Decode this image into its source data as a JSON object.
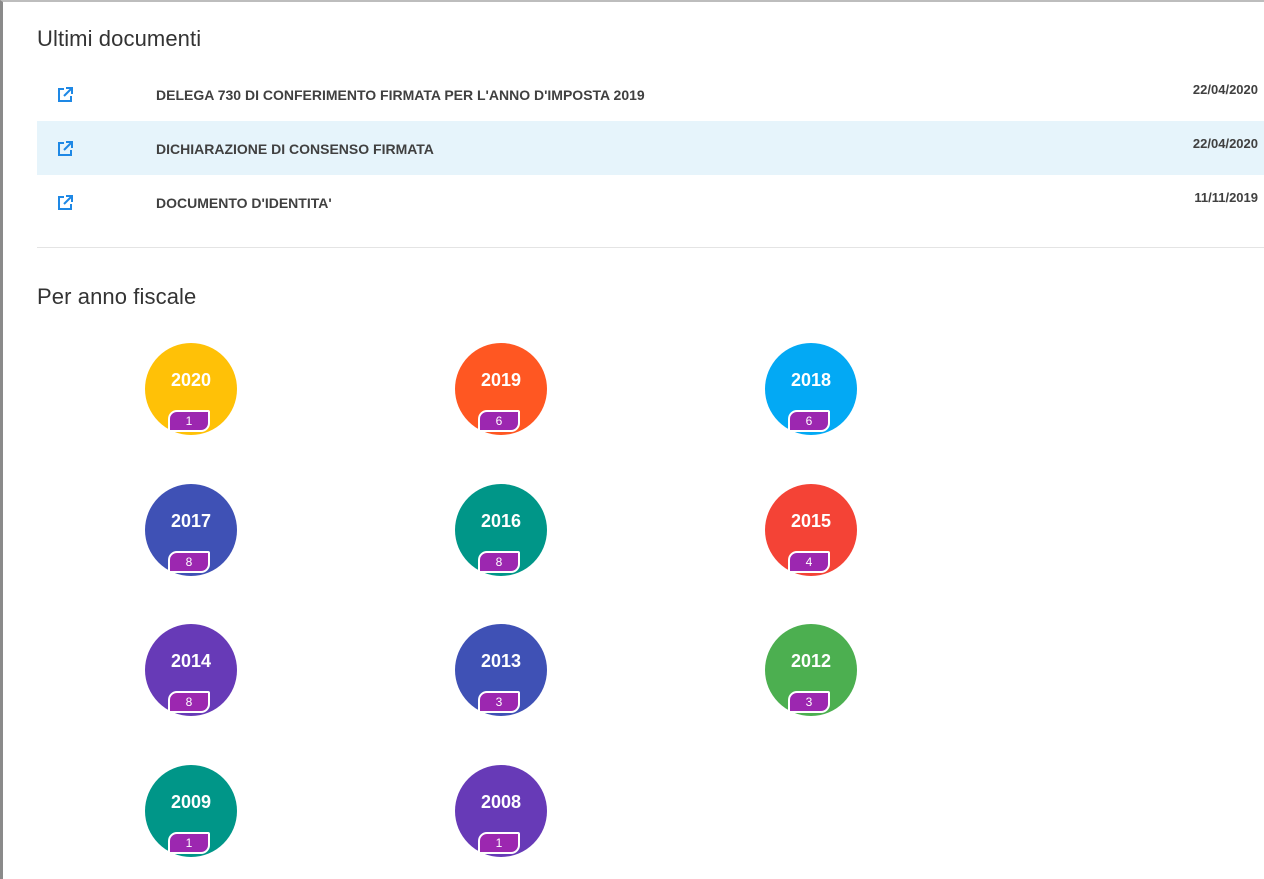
{
  "recent_documents": {
    "title": "Ultimi documenti",
    "items": [
      {
        "title": "DELEGA 730 DI CONFERIMENTO FIRMATA PER L'ANNO D'IMPOSTA 2019",
        "date": "22/04/2020",
        "icon": "open-external-icon"
      },
      {
        "title": "DICHIARAZIONE DI CONSENSO FIRMATA",
        "date": "22/04/2020",
        "icon": "open-external-icon"
      },
      {
        "title": "DOCUMENTO D'IDENTITA'",
        "date": "11/11/2019",
        "icon": "open-external-icon"
      }
    ]
  },
  "fiscal_years": {
    "title": "Per anno fiscale",
    "badge_color": "#9c27b0",
    "items": [
      {
        "year": "2020",
        "count": "1",
        "color": "#ffc107"
      },
      {
        "year": "2019",
        "count": "6",
        "color": "#ff5722"
      },
      {
        "year": "2018",
        "count": "6",
        "color": "#03a9f4"
      },
      {
        "year": "2017",
        "count": "8",
        "color": "#3f51b5"
      },
      {
        "year": "2016",
        "count": "8",
        "color": "#009688"
      },
      {
        "year": "2015",
        "count": "4",
        "color": "#f44336"
      },
      {
        "year": "2014",
        "count": "8",
        "color": "#673ab7"
      },
      {
        "year": "2013",
        "count": "3",
        "color": "#3f51b5"
      },
      {
        "year": "2012",
        "count": "3",
        "color": "#4caf50"
      },
      {
        "year": "2009",
        "count": "1",
        "color": "#009688"
      },
      {
        "year": "2008",
        "count": "1",
        "color": "#673ab7"
      }
    ]
  }
}
